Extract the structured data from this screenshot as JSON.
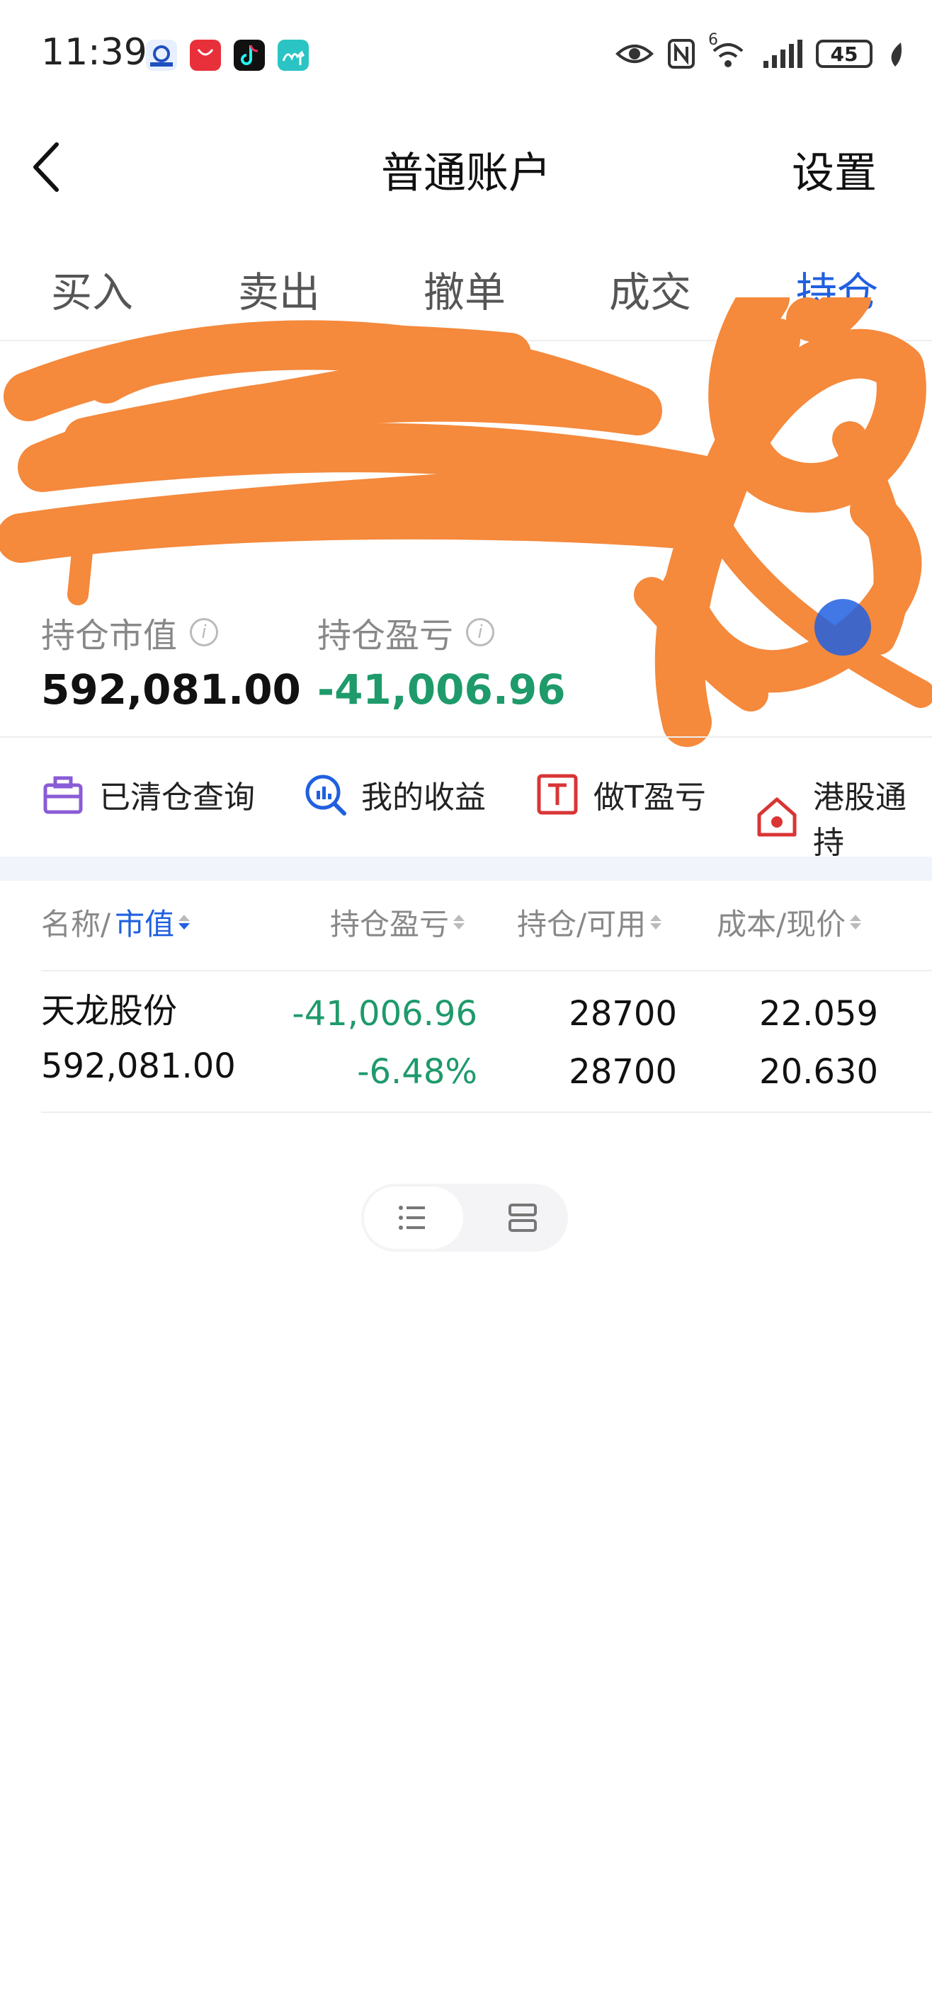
{
  "status_bar": {
    "time": "11:39",
    "network_label": "6",
    "battery": "45",
    "icons": [
      "app-icon",
      "huawei-appgallery-icon",
      "tiktok-icon",
      "camel-app-icon",
      "eye-icon",
      "nfc-icon",
      "wifi-icon",
      "signal-icon",
      "battery-icon",
      "leaf-icon"
    ]
  },
  "nav": {
    "title": "普通账户",
    "settings": "设置"
  },
  "tabs": [
    {
      "label": "买入"
    },
    {
      "label": "卖出"
    },
    {
      "label": "撤单"
    },
    {
      "label": "成交"
    },
    {
      "label": "持仓",
      "active": true
    }
  ],
  "summary": {
    "market_value_label": "持仓市值",
    "market_value": "592,081.00",
    "pnl_label": "持仓盈亏",
    "pnl": "-41,006.96"
  },
  "quick_links": [
    {
      "label": "已清仓查询",
      "icon": "briefcase-icon"
    },
    {
      "label": "我的收益",
      "icon": "chart-search-icon"
    },
    {
      "label": "做T盈亏",
      "icon": "t-box-icon"
    },
    {
      "label": "港股通持",
      "icon": "hk-house-icon"
    }
  ],
  "table": {
    "headers": {
      "name": "名称/",
      "name_sort": "市值",
      "pnl": "持仓盈亏",
      "position": "持仓/可用",
      "cost": "成本/现价"
    },
    "rows": [
      {
        "name": "天龙股份",
        "market_value": "592,081.00",
        "pnl": "-41,006.96",
        "pnl_pct": "-6.48%",
        "position": "28700",
        "available": "28700",
        "cost": "22.059",
        "price": "20.630"
      }
    ]
  },
  "colors": {
    "accent": "#2060e0",
    "loss": "#1e9a6b",
    "scribble": "#f5893c"
  }
}
